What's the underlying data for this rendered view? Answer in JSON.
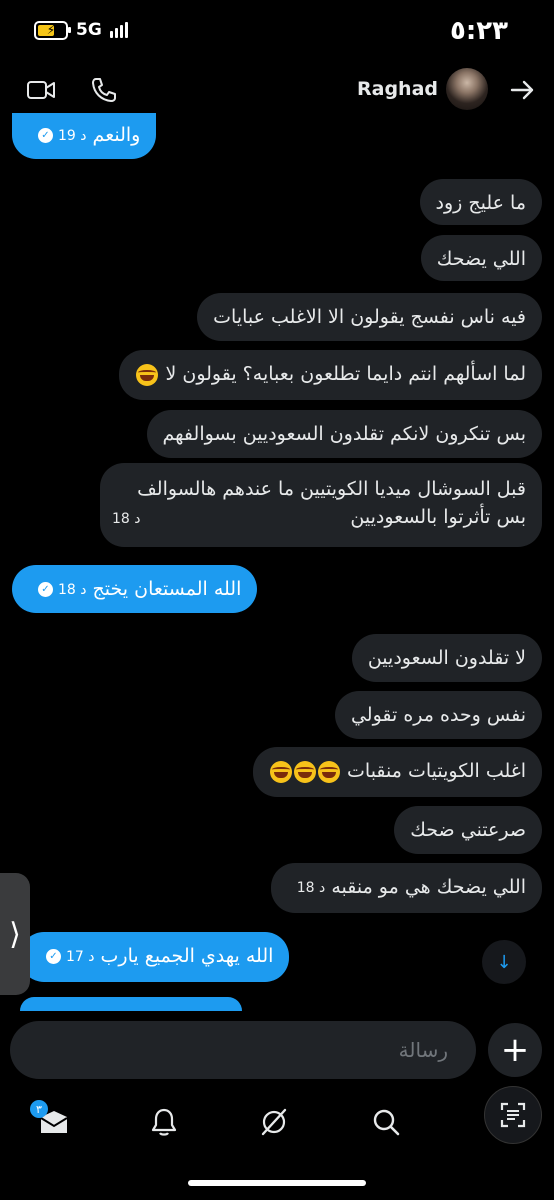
{
  "status_bar": {
    "network": "5G",
    "time": "٥:٢٣"
  },
  "header": {
    "contact_name": "Raghad"
  },
  "messages": [
    {
      "dir": "out",
      "text": "والنعم",
      "time": "19 د"
    },
    {
      "dir": "in",
      "text": "ما عليج زود"
    },
    {
      "dir": "in",
      "text": "اللي يضحك"
    },
    {
      "dir": "in",
      "text": "فيه ناس نفسج يقولون الا الاغلب عبايات"
    },
    {
      "dir": "in",
      "text": "لما اسألهم انتم دايما تطلعون بعبايه؟ يقولون لا",
      "emoji": "face-with-tears-of-joy"
    },
    {
      "dir": "in",
      "text": "بس تنكرون لانكم تقلدون السعوديين بسوالفهم"
    },
    {
      "dir": "in",
      "line1": "قبل السوشال ميديا الكويتيين ما عندهم هالسوالف",
      "line2": "بس تأثرتوا بالسعوديين",
      "time": "18 د"
    },
    {
      "dir": "out",
      "text": "الله المستعان يختج",
      "time": "18 د"
    },
    {
      "dir": "in",
      "text": "لا تقلدون السعوديين"
    },
    {
      "dir": "in",
      "text": "نفس وحده مره تقولي"
    },
    {
      "dir": "in",
      "text": "اغلب الكويتيات منقبات",
      "emoji": "face-with-tears-of-joy x3"
    },
    {
      "dir": "in",
      "text": "صرعتني ضحك"
    },
    {
      "dir": "in",
      "text": "اللي يضحك هي مو منقبه",
      "time": "18 د"
    },
    {
      "dir": "out",
      "text": "الله يهدي الجميع يارب",
      "time": "17 د"
    }
  ],
  "composer": {
    "placeholder": "رسالة"
  },
  "nav": {
    "messages_badge": "٣"
  },
  "colors": {
    "accent": "#1d9bf0",
    "incoming_bubble": "#202327",
    "background": "#000000"
  }
}
